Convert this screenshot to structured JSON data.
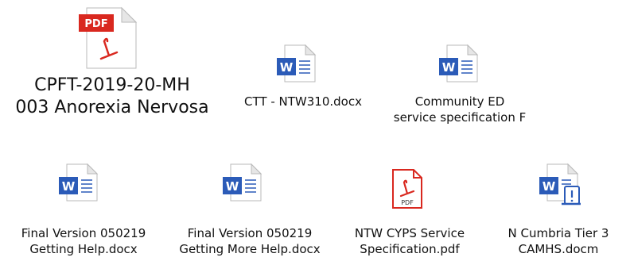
{
  "files": [
    {
      "name_line1": "CPFT-2019-20-MH",
      "name_line2": "003 Anorexia Nervosa",
      "type_badge": "PDF",
      "icon": "pdf-file-icon"
    },
    {
      "name_line1": "CTT - NTW310.docx",
      "type_badge": "W",
      "icon": "word-document-icon"
    },
    {
      "name_line1": "Community ED",
      "name_line2": "service specification F",
      "type_badge": "W",
      "icon": "word-document-icon"
    },
    {
      "name_line1": "Final Version 050219",
      "name_line2": "Getting Help.docx",
      "type_badge": "W",
      "icon": "word-document-icon"
    },
    {
      "name_line1": "Final Version 050219",
      "name_line2": "Getting More Help.docx",
      "type_badge": "W",
      "icon": "word-document-icon"
    },
    {
      "name_line1": "NTW CYPS Service",
      "name_line2": "Specification.pdf",
      "type_badge": "PDF",
      "icon": "pdf-file-icon"
    },
    {
      "name_line1": "N Cumbria Tier 3",
      "name_line2": "CAMHS.docm",
      "type_badge": "W",
      "icon": "word-macro-document-icon"
    }
  ],
  "colors": {
    "word_blue": "#2b5bb8",
    "pdf_red": "#d9281f",
    "page_border": "#b9b9b9"
  }
}
